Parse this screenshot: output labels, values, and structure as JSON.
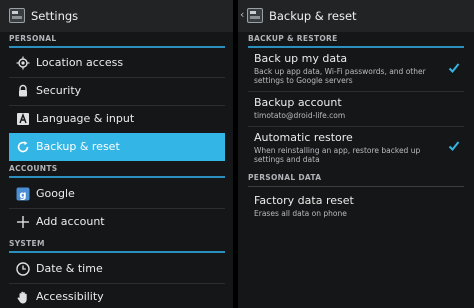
{
  "colors": {
    "accent": "#33b5e5",
    "section_underline": "#2a8fbd",
    "background": "#151617",
    "actionbar": "#222324"
  },
  "left": {
    "title": "Settings",
    "icon": "settings-app-icon",
    "sections": [
      {
        "label": "PERSONAL"
      },
      {
        "label": "ACCOUNTS"
      },
      {
        "label": "SYSTEM"
      }
    ],
    "items": [
      {
        "label": "Location access",
        "icon": "location-icon"
      },
      {
        "label": "Security",
        "icon": "lock-icon"
      },
      {
        "label": "Language & input",
        "icon": "keyboard-icon"
      },
      {
        "label": "Backup & reset",
        "icon": "backup-icon",
        "selected": true
      },
      {
        "label": "Google",
        "icon": "google-icon"
      },
      {
        "label": "Add account",
        "icon": "plus-icon"
      },
      {
        "label": "Date & time",
        "icon": "clock-icon"
      },
      {
        "label": "Accessibility",
        "icon": "hand-icon"
      }
    ]
  },
  "right": {
    "title": "Backup & reset",
    "sections": [
      {
        "label": "BACKUP & RESTORE"
      },
      {
        "label": "PERSONAL DATA"
      }
    ],
    "items": [
      {
        "title": "Back up my data",
        "summary": "Back up app data, Wi-Fi passwords, and other settings to Google servers",
        "checked": true
      },
      {
        "title": "Backup account",
        "summary": "timotato@droid-life.com"
      },
      {
        "title": "Automatic restore",
        "summary": "When reinstalling an app, restore backed up settings and data",
        "checked": true
      },
      {
        "title": "Factory data reset",
        "summary": "Erases all data on phone"
      }
    ]
  }
}
